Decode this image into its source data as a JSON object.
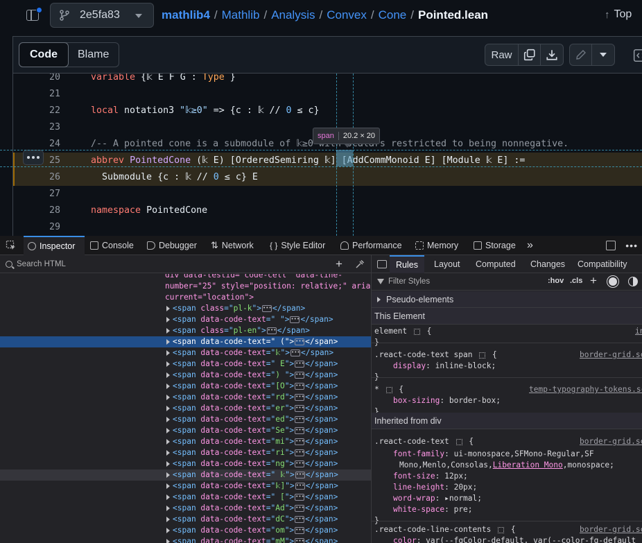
{
  "header": {
    "branch": "2e5fa83",
    "breadcrumb": {
      "repo": "mathlib4",
      "segments": [
        "Mathlib",
        "Analysis",
        "Convex",
        "Cone"
      ],
      "separator": "/",
      "file": "Pointed.lean"
    },
    "top_label": "Top",
    "top_arrow": "↑"
  },
  "toolbar": {
    "tab_code": "Code",
    "tab_blame": "Blame",
    "raw_label": "Raw"
  },
  "code": {
    "lines": [
      {
        "n": "20",
        "segs": [
          [
            "kw",
            "variable"
          ],
          [
            "",
            " {𝕜 E F G : "
          ],
          [
            "ent",
            "Type"
          ],
          [
            "",
            " }"
          ]
        ]
      },
      {
        "n": "21",
        "segs": []
      },
      {
        "n": "22",
        "segs": [
          [
            "kw",
            "local"
          ],
          [
            "",
            " notation3 "
          ],
          [
            "str",
            "\"𝕜≥0\""
          ],
          [
            "",
            " => {c : 𝕜 // "
          ],
          [
            "num",
            "0"
          ],
          [
            "",
            " ≤ c}"
          ]
        ]
      },
      {
        "n": "23",
        "segs": []
      },
      {
        "n": "24",
        "segs": [
          [
            "cmt",
            "/-- A pointed cone is a submodule of 𝕜≥0 with scalars restricted to being nonnegative."
          ]
        ]
      },
      {
        "n": "25",
        "segs": [
          [
            "kw",
            "abbrev"
          ],
          [
            "",
            " "
          ],
          [
            "fn",
            "PointedCone"
          ],
          [
            "",
            " (𝕜 E) [OrderedSemiring 𝕜] [AddCommMonoid E] [Module 𝕜 E] :="
          ]
        ]
      },
      {
        "n": "26",
        "segs": [
          [
            "",
            "  Submodule {c : 𝕜 // "
          ],
          [
            "num",
            "0"
          ],
          [
            "",
            " ≤ c} E"
          ]
        ]
      },
      {
        "n": "27",
        "segs": []
      },
      {
        "n": "28",
        "segs": [
          [
            "kw",
            "namespace"
          ],
          [
            "",
            " PointedCone"
          ]
        ]
      },
      {
        "n": "29",
        "segs": []
      }
    ],
    "tooltip": {
      "tag": "span",
      "dims": "20.2 × 20"
    }
  },
  "devtools": {
    "tabs": [
      "Inspector",
      "Console",
      "Debugger",
      "Network",
      "Style Editor",
      "Performance",
      "Memory",
      "Storage"
    ],
    "more": "»",
    "search_placeholder": "Search HTML",
    "markup": {
      "top1": "div data-testid=\"code-cell\" data-line-",
      "top2": "number=\"25\" style=\"position: relative;\" aria-",
      "top3": "current=\"location\">",
      "rows": [
        {
          "attr": "class",
          "val": "pl-k",
          "close": "</span>"
        },
        {
          "attr": "data-code-text",
          "val": " ",
          "close": "</span>"
        },
        {
          "attr": "class",
          "val": "pl-en",
          "close": "</span>"
        },
        {
          "attr": "data-code-text",
          "val": " (",
          "close": "</span>"
        },
        {
          "attr": "data-code-text",
          "val": "𝕜",
          "close": "</span>"
        },
        {
          "attr": "data-code-text",
          "val": " E",
          "close": "</span>"
        },
        {
          "attr": "data-code-text",
          "val": ") ",
          "close": "</span>"
        },
        {
          "attr": "data-code-text",
          "val": "[O",
          "close": "</span>"
        },
        {
          "attr": "data-code-text",
          "val": "rd",
          "close": "</span>"
        },
        {
          "attr": "data-code-text",
          "val": "er",
          "close": "</span>"
        },
        {
          "attr": "data-code-text",
          "val": "ed",
          "close": "</span>"
        },
        {
          "attr": "data-code-text",
          "val": "Se",
          "close": "</span>"
        },
        {
          "attr": "data-code-text",
          "val": "mi",
          "close": "</span>"
        },
        {
          "attr": "data-code-text",
          "val": "ri",
          "close": "</span>"
        },
        {
          "attr": "data-code-text",
          "val": "ng",
          "close": "</span>"
        },
        {
          "attr": "data-code-text",
          "val": " 𝕜",
          "close": "</span>"
        },
        {
          "attr": "data-code-text",
          "val": "𝕜]",
          "close": "</span>"
        },
        {
          "attr": "data-code-text",
          "val": " [",
          "close": "</span>"
        },
        {
          "attr": "data-code-text",
          "val": "Ad",
          "close": "</span>"
        },
        {
          "attr": "data-code-text",
          "val": "dC",
          "close": "</span>"
        },
        {
          "attr": "data-code-text",
          "val": "om",
          "close": "</span>"
        },
        {
          "attr": "data-code-text",
          "val": "mM",
          "close": "</span>"
        }
      ]
    },
    "rules_tabs": [
      "Rules",
      "Layout",
      "Computed",
      "Changes",
      "Compatibility"
    ],
    "filter_placeholder": "Filter Styles",
    "filter_opts": [
      ":hov",
      ".cls",
      "+"
    ],
    "pseudo": "Pseudo-elements",
    "this_element": "This Element",
    "inherited": "Inherited from div",
    "rules": {
      "element_sel": "element",
      "element_src": "in",
      "r1_sel": ".react-code-text span",
      "r1_src": "border-grid.sc",
      "r1_prop": "display",
      "r1_val": "inline-block;",
      "r2_sel": "*",
      "r2_src": "temp-typography-tokens.sc",
      "r2_prop": "box-sizing",
      "r2_val": "border-box;",
      "r3_sel": ".react-code-text",
      "r3_src": "border-grid.sc",
      "r3_p1": "font-family",
      "r3_v1a": "ui-monospace,SFMono-Regular,SF",
      "r3_v1b": "Mono,Menlo,Consolas,",
      "r3_v1link": "Liberation Mono",
      "r3_v1c": ",monospace;",
      "r3_p2": "font-size",
      "r3_v2": "12px;",
      "r3_p3": "line-height",
      "r3_v3": "20px;",
      "r3_p4": "word-wrap",
      "r3_v4": "normal;",
      "r3_p5": "white-space",
      "r3_v5": "pre;",
      "r4_sel": ".react-code-line-contents",
      "r4_src": "border-grid.sc",
      "r4_p1": "color",
      "r4_v1": "var(--fgColor-default, var(--color-fg-default"
    }
  }
}
